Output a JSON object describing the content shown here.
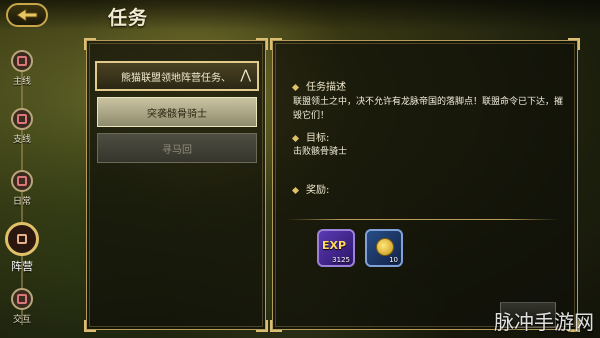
{
  "header": {
    "title": "任务"
  },
  "nav": {
    "items": [
      {
        "label": "主线",
        "icon": "main-quest-icon"
      },
      {
        "label": "支线",
        "icon": "side-quest-icon"
      },
      {
        "label": "日常",
        "icon": "daily-quest-icon"
      },
      {
        "label": "阵营",
        "icon": "faction-quest-icon",
        "active": true
      },
      {
        "label": "交互",
        "icon": "interaction-quest-icon"
      }
    ]
  },
  "quests": {
    "main_title": "熊猫联盟领地阵营任务、",
    "selected": "突袭骸骨骑士",
    "disabled": "寻马回"
  },
  "detail": {
    "desc_header": "任务描述",
    "desc_text": "联盟领土之中，决不允许有龙脉帝国的落脚点！联盟命令已下达，摧毁它们！",
    "goal_header": "目标:",
    "goal_text": "击败骸骨骑士",
    "reward_header": "奖励:",
    "rewards": [
      {
        "name": "EXP",
        "count": "3125"
      },
      {
        "name": "金币",
        "count": "10"
      }
    ]
  },
  "watermark": "脉冲手游网",
  "colors": {
    "accent_gold": "#d9be74",
    "panel_border": "#b79c5b"
  }
}
